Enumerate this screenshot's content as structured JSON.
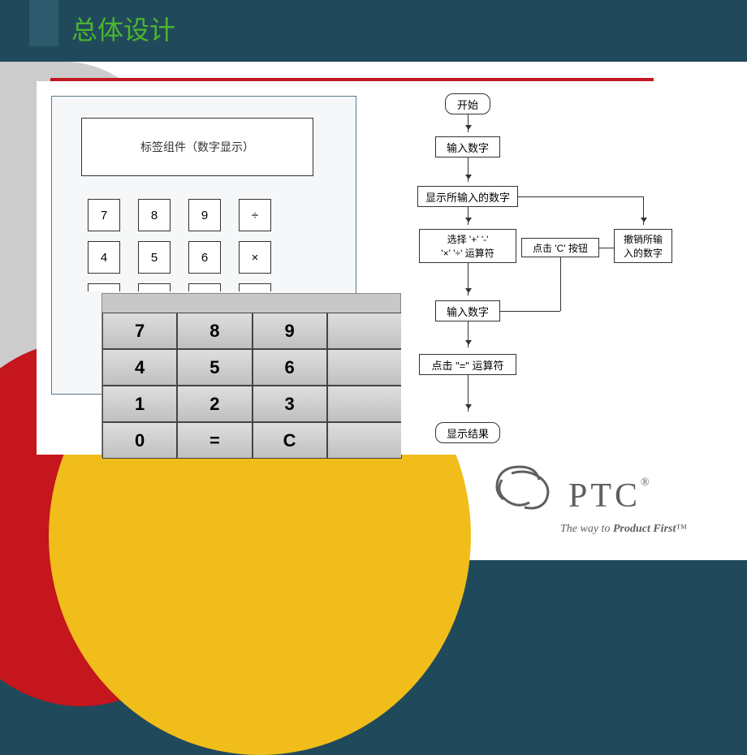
{
  "title": "总体设计",
  "wire_calc": {
    "display": "标签组件（数字显示）",
    "rows": [
      [
        "7",
        "8",
        "9",
        "÷"
      ],
      [
        "4",
        "5",
        "6",
        "×"
      ]
    ]
  },
  "real_calc": {
    "keys": [
      "7",
      "8",
      "9",
      "",
      "4",
      "5",
      "6",
      "",
      "1",
      "2",
      "3",
      "",
      "0",
      "=",
      "C",
      ""
    ]
  },
  "flow": {
    "n0": "开始",
    "n1": "输入数字",
    "n2": "显示所输入的数字",
    "n3": "选择 '+' '-'\n'×' '÷' 运算符",
    "n3b": "点击 'C' 按钮",
    "n3c": "撤销所输\n入的数字",
    "n4": "输入数字",
    "n5": "点击 \"=\" 运算符",
    "n6": "显示结果"
  },
  "logo": {
    "brand": "PTC",
    "reg": "®",
    "tagline_1": "The way to ",
    "tagline_2": "Product First",
    "tm": "™"
  }
}
